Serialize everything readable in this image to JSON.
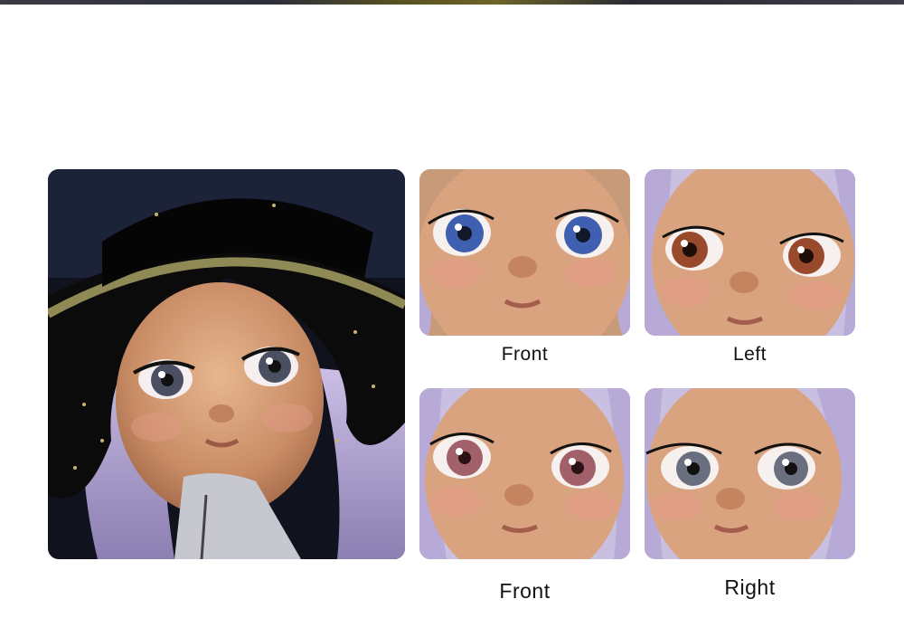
{
  "captions": {
    "front_top": "Front",
    "left": "Left",
    "front_bottom": "Front",
    "right": "Right"
  },
  "colors": {
    "skin": "#d8a27c",
    "hair": "#b8aad6",
    "hat": "#141414",
    "eye_blue": "#3f5fb0",
    "eye_brown": "#9a4a2c",
    "eye_pink": "#a2616a",
    "eye_gray": "#6a6f80"
  },
  "icons": [
    "doll-photo-main",
    "doll-face-front-blue",
    "doll-face-left-brown",
    "doll-face-front-pink",
    "doll-face-right-gray"
  ]
}
